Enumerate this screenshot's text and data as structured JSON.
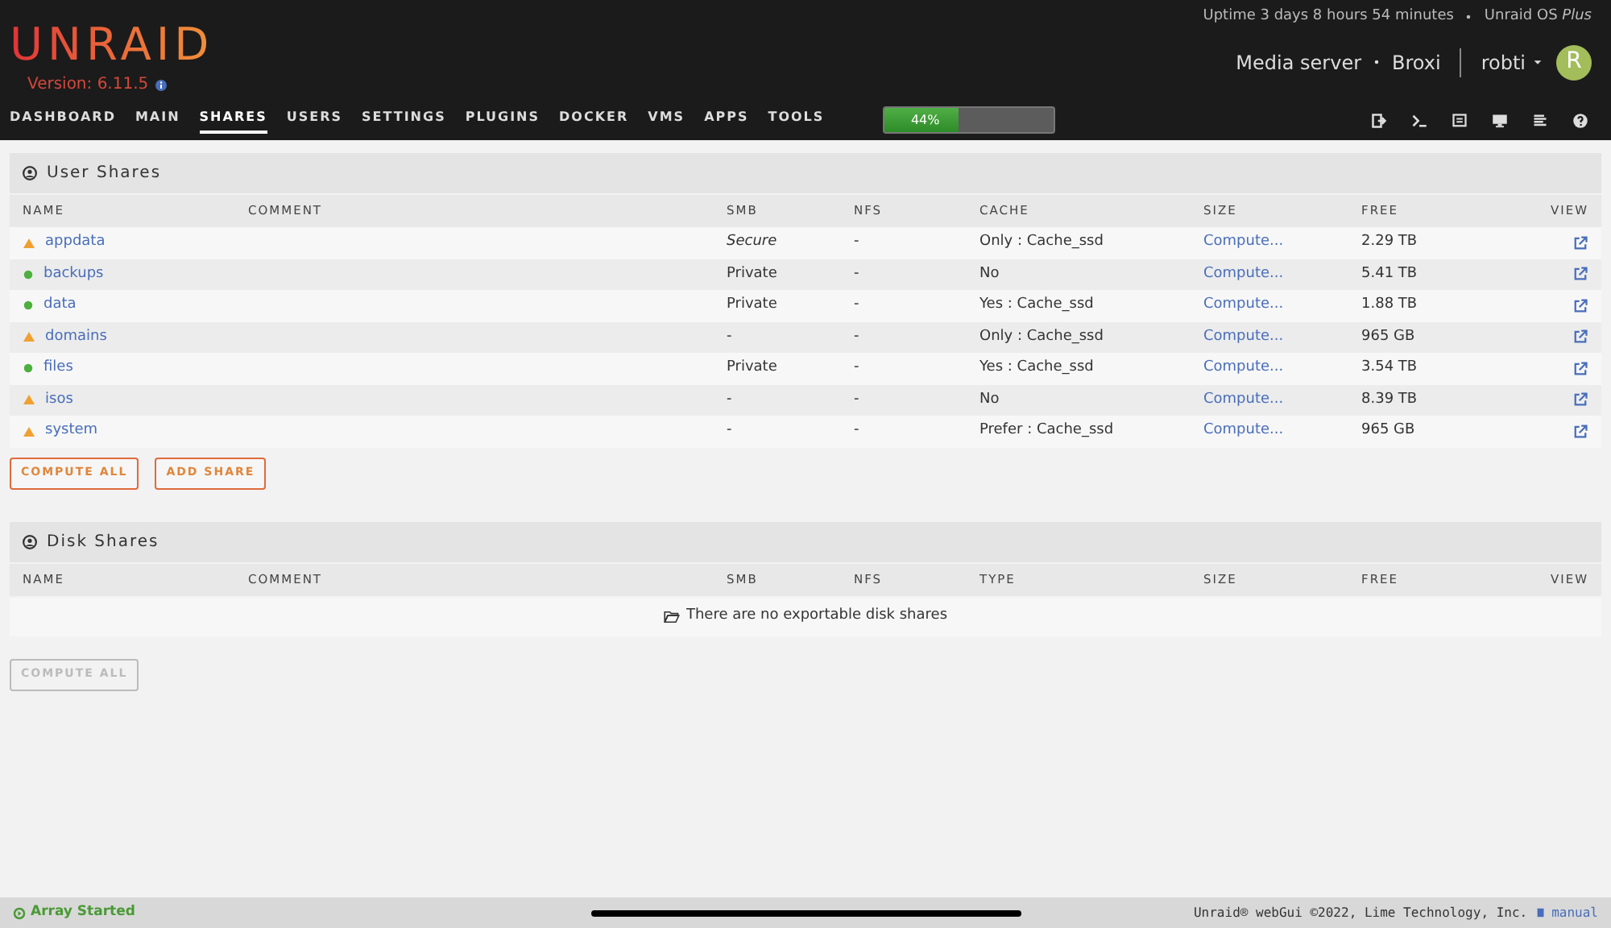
{
  "header": {
    "logo": "UNRAID",
    "version": "Version: 6.11.5",
    "uptime": "Uptime 3 days 8 hours 54 minutes",
    "license": "Unraid OS *Plus*",
    "server_name": "Media server",
    "server_desc": "Broxi",
    "user": "robti",
    "avatar_letter": "R"
  },
  "nav": [
    {
      "label": "DASHBOARD",
      "selected": false
    },
    {
      "label": "MAIN",
      "selected": false
    },
    {
      "label": "SHARES",
      "selected": true
    },
    {
      "label": "USERS",
      "selected": false
    },
    {
      "label": "SETTINGS",
      "selected": false
    },
    {
      "label": "PLUGINS",
      "selected": false
    },
    {
      "label": "DOCKER",
      "selected": false
    },
    {
      "label": "VMS",
      "selected": false
    },
    {
      "label": "APPS",
      "selected": false
    },
    {
      "label": "TOOLS",
      "selected": false
    }
  ],
  "usage_bar": {
    "level": 0.44,
    "reading": "44%"
  },
  "user_shares": {
    "title": "User Shares",
    "columns": [
      "NAME",
      "COMMENT",
      "SMB",
      "NFS",
      "CACHE",
      "SIZE",
      "FREE",
      "VIEW"
    ],
    "rows": [
      {
        "kind": "warning",
        "name": "appdata",
        "smb": "Secure",
        "smb_italic": true,
        "nfs": "-",
        "cache": "Only : Cache_ssd",
        "size": "Compute...",
        "free": "2.29 TB"
      },
      {
        "kind": "ok",
        "name": "backups",
        "smb": "Private",
        "smb_italic": false,
        "nfs": "-",
        "cache": "No",
        "size": "Compute...",
        "free": "5.41 TB"
      },
      {
        "kind": "ok",
        "name": "data",
        "smb": "Private",
        "smb_italic": false,
        "nfs": "-",
        "cache": "Yes : Cache_ssd",
        "size": "Compute...",
        "free": "1.88 TB"
      },
      {
        "kind": "warning",
        "name": "domains",
        "smb": "-",
        "smb_italic": false,
        "nfs": "-",
        "cache": "Only : Cache_ssd",
        "size": "Compute...",
        "free": "965 GB"
      },
      {
        "kind": "ok",
        "name": "files",
        "smb": "Private",
        "smb_italic": false,
        "nfs": "-",
        "cache": "Yes : Cache_ssd",
        "size": "Compute...",
        "free": "3.54 TB"
      },
      {
        "kind": "warning",
        "name": "isos",
        "smb": "-",
        "smb_italic": false,
        "nfs": "-",
        "cache": "No",
        "size": "Compute...",
        "free": "8.39 TB"
      },
      {
        "kind": "warning",
        "name": "system",
        "smb": "-",
        "smb_italic": false,
        "nfs": "-",
        "cache": "Prefer : Cache_ssd",
        "size": "Compute...",
        "free": "965 GB"
      }
    ],
    "buttons": [
      {
        "label": "COMPUTE ALL",
        "disabled": false
      },
      {
        "label": "ADD SHARE",
        "disabled": false
      }
    ]
  },
  "disk_shares": {
    "title": "Disk Shares",
    "columns": [
      "NAME",
      "COMMENT",
      "SMB",
      "NFS",
      "TYPE",
      "SIZE",
      "FREE",
      "VIEW"
    ],
    "empty_message": "There are no exportable disk shares",
    "buttons": [
      {
        "label": "COMPUTE ALL",
        "disabled": true
      }
    ]
  },
  "status_bar": {
    "array_status": "Array Started",
    "copyright": "Unraid® webGui ©2022, Lime Technology, Inc.",
    "manual": "manual"
  }
}
